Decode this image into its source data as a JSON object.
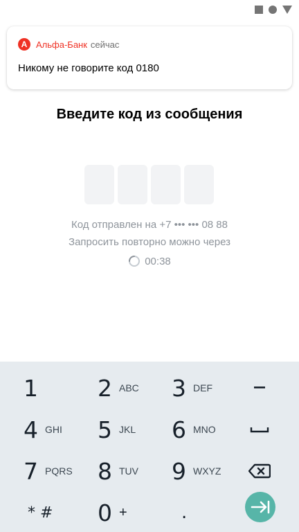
{
  "status_bar": {
    "icons": [
      "square-icon",
      "circle-icon",
      "triangle-icon"
    ]
  },
  "notification": {
    "app_logo_letter": "А",
    "app_name": "Альфа-Банк",
    "time": "сейчас",
    "message": "Никому не говорите код 0180"
  },
  "page": {
    "title": "Введите код из сообщения",
    "code_length": 4,
    "sent_to": "Код отправлен на +7 ••• ••• 08 88",
    "resend_label": "Запросить повторно можно через",
    "timer": "00:38"
  },
  "keyboard": {
    "keys": [
      {
        "num": "1",
        "letters": ""
      },
      {
        "num": "2",
        "letters": "ABC"
      },
      {
        "num": "3",
        "letters": "DEF"
      },
      {
        "num": "4",
        "letters": "GHI"
      },
      {
        "num": "5",
        "letters": "JKL"
      },
      {
        "num": "6",
        "letters": "MNO"
      },
      {
        "num": "7",
        "letters": "PQRS"
      },
      {
        "num": "8",
        "letters": "TUV"
      },
      {
        "num": "9",
        "letters": "WXYZ"
      },
      {
        "num": "* #",
        "letters": ""
      },
      {
        "num": "0",
        "letters": "+"
      },
      {
        "num": ".",
        "letters": ""
      }
    ],
    "side_keys": [
      "minus-key",
      "space-key",
      "backspace-key",
      "enter-key"
    ]
  },
  "colors": {
    "brand": "#ef3124",
    "keyboard_bg": "#e6ebef",
    "enter_button": "#57b5a8",
    "code_box": "#f2f3f5",
    "muted_text": "#8e949b"
  }
}
